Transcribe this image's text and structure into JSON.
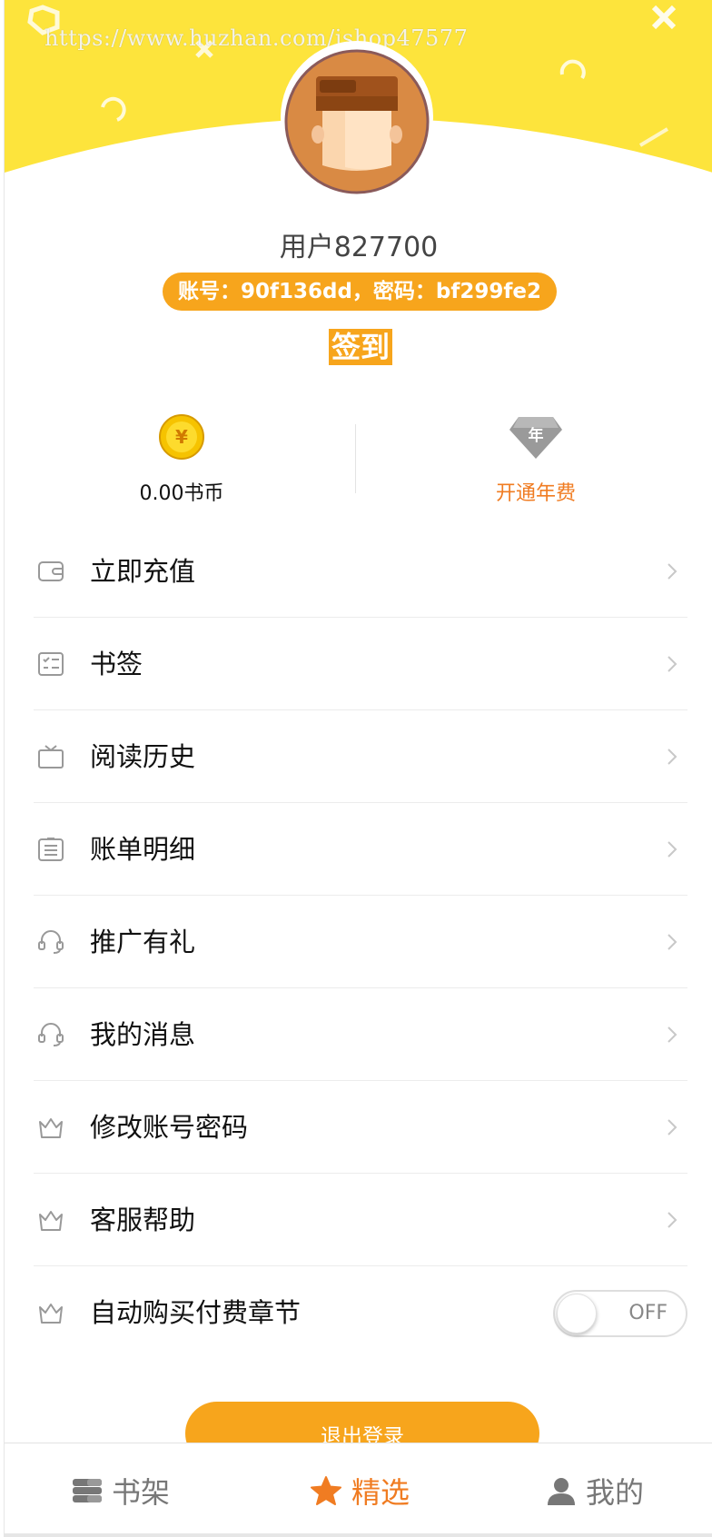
{
  "watermark": "https://www.huzhan.com/ishop47577",
  "profile": {
    "username": "用户827700",
    "account_info": "账号：90f136dd，密码：bf299fe2",
    "checkin_label": "签到"
  },
  "stats": {
    "coins_label": "0.00书币",
    "coin_icon_text": "¥",
    "annual_label": "开通年费",
    "annual_icon_text": "年"
  },
  "menu": {
    "items": [
      {
        "label": "立即充值",
        "icon": "wallet-icon"
      },
      {
        "label": "书签",
        "icon": "checklist-icon"
      },
      {
        "label": "阅读历史",
        "icon": "tv-history-icon"
      },
      {
        "label": "账单明细",
        "icon": "bill-list-icon"
      },
      {
        "label": "推广有礼",
        "icon": "headset-icon"
      },
      {
        "label": "我的消息",
        "icon": "headset-icon"
      },
      {
        "label": "修改账号密码",
        "icon": "crown-icon"
      },
      {
        "label": "客服帮助",
        "icon": "crown-icon"
      },
      {
        "label": "自动购买付费章节",
        "icon": "crown-icon"
      }
    ],
    "auto_buy_toggle": "OFF"
  },
  "logout_label": "退出登录",
  "tabbar": {
    "shelf": "书架",
    "featured": "精选",
    "mine": "我的"
  },
  "colors": {
    "header_yellow": "#fde43c",
    "accent_orange": "#f7a51c",
    "active_tab": "#f07c22"
  }
}
